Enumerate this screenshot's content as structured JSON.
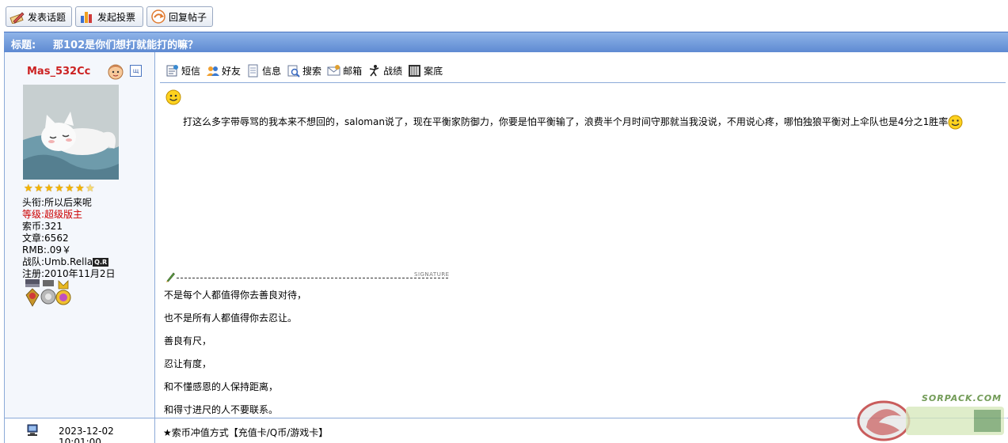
{
  "toolbar": {
    "new_topic": "发表话题",
    "new_poll": "发起投票",
    "reply": "回复帖子"
  },
  "thread": {
    "title_label": "标题:",
    "title": "那102是你们想打就能打的嘛？"
  },
  "author": {
    "name": "Mas_532Cc",
    "online_badge": "щ",
    "stars": 7,
    "title_label": "头衔:",
    "title_value": "所以后来呢",
    "level_label": "等级:",
    "level_value": "超级版主",
    "coins_label": "索币:",
    "coins_value": "321",
    "posts_label": "文章:",
    "posts_value": "6562",
    "rmb_label": "RMB:",
    "rmb_value": ".09￥",
    "team_label": "战队:",
    "team_value": "Umb.Rella",
    "team_tag": "Q.R",
    "reg_label": "注册:",
    "reg_value": "2010年11月2日"
  },
  "actions": {
    "sms": "短信",
    "friend": "好友",
    "info": "信息",
    "search": "搜索",
    "mail": "邮箱",
    "record": "战绩",
    "archive": "案底"
  },
  "post": {
    "message": "打这么多字带辱骂的我本来不想回的，saloman说了，现在平衡家防御力，你要是怕平衡输了，浪费半个月时间守那就当我没说，不用说心疼，哪怕独狼平衡对上伞队也是4分之1胜率",
    "signature_label": "SIGNATURE",
    "signature_lines": [
      "不是每个人都值得你去善良对待，",
      "也不是所有人都值得你去忍让。",
      "善良有尺，",
      "忍让有度，",
      "和不懂感恩的人保持距离，",
      "和得寸进尺的人不要联系。"
    ]
  },
  "footer": {
    "timestamp": "2023-12-02 10:01:00",
    "link": "★索币冲值方式【充值卡/Q币/游戏卡】"
  },
  "watermark": {
    "text": "SORPACK.COM"
  },
  "colors": {
    "titlebar": "#5e8ad2",
    "username": "#cc2222",
    "level": "#cc0000",
    "border": "#8caad8",
    "sidebar_bg": "#f4f7fc"
  }
}
